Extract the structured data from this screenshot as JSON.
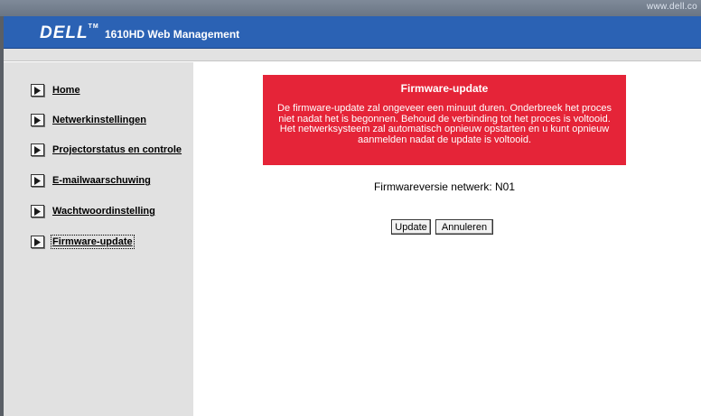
{
  "top_bar": {
    "url_text": "www.dell.co"
  },
  "header": {
    "logo_text": "DELL",
    "logo_tm": "TM",
    "app_title": "1610HD Web Management"
  },
  "sidebar": {
    "items": [
      {
        "label": "Home"
      },
      {
        "label": "Netwerkinstellingen"
      },
      {
        "label": "Projectorstatus en controle"
      },
      {
        "label": "E-mailwaarschuwing"
      },
      {
        "label": "Wachtwoordinstelling"
      },
      {
        "label": "Firmware-update",
        "selected": true
      }
    ]
  },
  "alert": {
    "title": "Firmware-update",
    "message": "De firmware-update zal ongeveer een minuut duren. Onderbreek het proces niet nadat het is begonnen. Behoud de verbinding tot het proces is voltooid. Het netwerksysteem zal automatisch opnieuw opstarten en u kunt opnieuw aanmelden nadat de update is voltooid.",
    "background_color": "#e52438"
  },
  "firmware": {
    "label": "Firmwareversie netwerk:",
    "value": "N01"
  },
  "buttons": {
    "update_label": "Update",
    "cancel_label": "Annuleren"
  },
  "colors": {
    "header_blue": "#2b62b4",
    "sidebar_gray": "#e1e1e1"
  }
}
